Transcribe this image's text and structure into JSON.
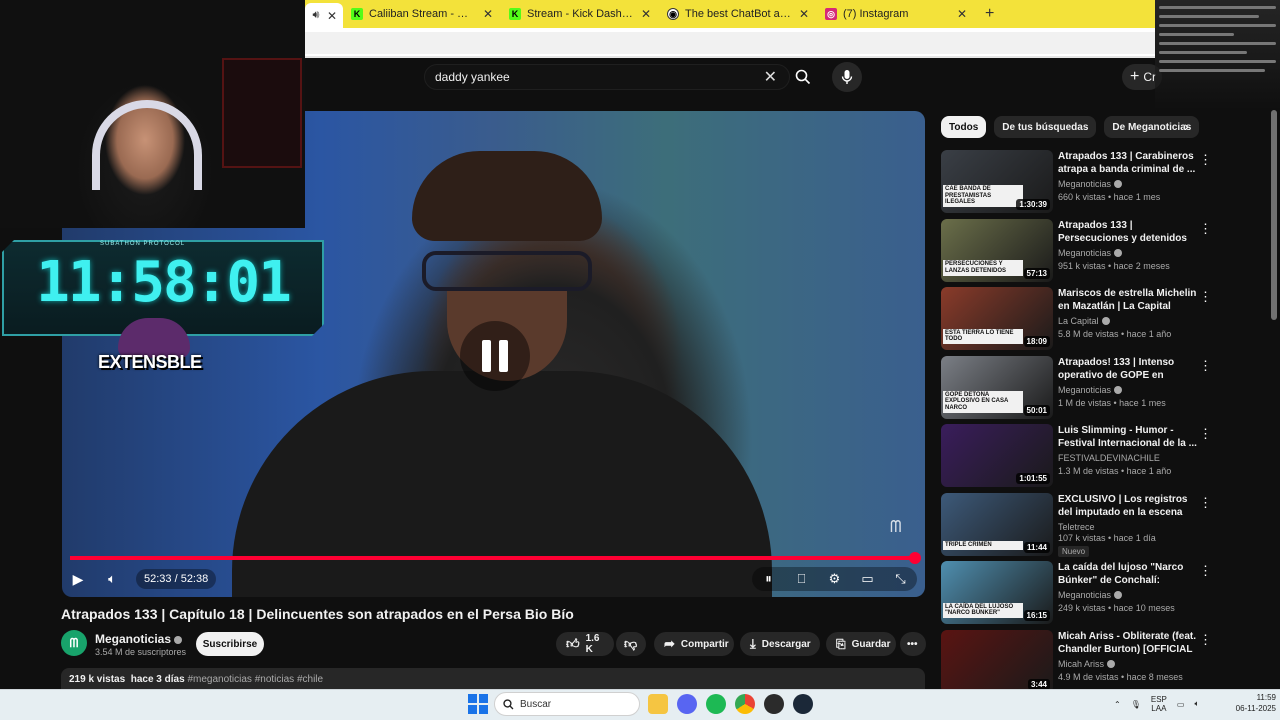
{
  "browser": {
    "tabs": [
      {
        "title": "",
        "active": true,
        "favicon": "speaker-icon"
      },
      {
        "title": "Caliiban Stream - Watch Live on Kick",
        "favicon_color": "#53fc18",
        "favicon_letter": "K"
      },
      {
        "title": "Stream - Kick Dashboard",
        "favicon_color": "#53fc18",
        "favicon_letter": "K"
      },
      {
        "title": "The best ChatBot and Widgets",
        "favicon_color": "#ffffff",
        "favicon_letter": "◉"
      },
      {
        "title": "(7) Instagram",
        "favicon_color": "#d62976",
        "favicon_letter": "◎"
      }
    ],
    "newtab": "+",
    "tab_close": "✕"
  },
  "youtube": {
    "search_query": "daddy yankee",
    "create_label": "Cr"
  },
  "player": {
    "current_time": "52:33",
    "duration": "52:38",
    "time_display": "52:33 / 52:38",
    "progress": 0.998
  },
  "video": {
    "title": "Atrapados 133 | Capítulo 18 | Delincuentes son atrapados en el Persa Bio Bío",
    "channel": "Meganoticias",
    "subscribers": "3.54 M de suscriptores",
    "subscribe_label": "Suscribirse",
    "likes": "1.6 K",
    "share_label": "Compartir",
    "download_label": "Descargar",
    "save_label": "Guardar",
    "views": "219 k vistas",
    "age": "hace 3 días",
    "tags": "#meganoticias #noticias #chile"
  },
  "sidebar": {
    "chips": [
      "Todos",
      "De tus búsquedas",
      "De Meganoticias"
    ],
    "recommendations": [
      {
        "title": "Atrapados 133 | Carabineros atrapa a banda criminal de ...",
        "channel": "Meganoticias",
        "verified": true,
        "meta": "660 k vistas • hace 1 mes",
        "duration": "1:30:39",
        "banner": "CAE BANDA DE PRESTAMISTAS ILEGALES",
        "thumb": "#3a3f46"
      },
      {
        "title": "Atrapados 133 | Persecuciones y detenidos en las calles: El ...",
        "channel": "Meganoticias",
        "verified": true,
        "meta": "951 k vistas • hace 2 meses",
        "duration": "57:13",
        "banner": "PERSECUCIONES Y LANZAS DETENIDOS",
        "thumb": "#6b6f4a"
      },
      {
        "title": "Mariscos de estrella Michelin en Mazatlán | La Capital",
        "channel": "La Capital",
        "verified": true,
        "meta": "5.8 M de vistas • hace 1 año",
        "duration": "18:09",
        "banner": "ESTA TIERRA LO TIENE TODO",
        "thumb": "#8a3b2a"
      },
      {
        "title": "Atrapados! 133 | Intenso operativo de GOPE en Melipill...",
        "channel": "Meganoticias",
        "verified": true,
        "meta": "1 M de vistas • hace 1 mes",
        "duration": "50:01",
        "banner": "GOPE DETONA EXPLOSIVO EN CASA NARCO",
        "thumb": "#7b7f86"
      },
      {
        "title": "Luis Slimming - Humor - Festival Internacional de la ...",
        "channel": "FESTIVALDEVINACHILE",
        "verified": false,
        "meta": "1.3 M de vistas • hace 1 año",
        "duration": "1:01:55",
        "banner": "",
        "thumb": "#3a1d5c"
      },
      {
        "title": "EXCLUSIVO | Los registros del imputado en la escena del tripl...",
        "channel": "Teletrece",
        "verified": false,
        "meta": "107 k vistas • hace 1 día",
        "duration": "11:44",
        "banner": "TRIPLE CRIMEN",
        "badge": "Nuevo",
        "thumb": "#3d5a7a"
      },
      {
        "title": "La caída del lujoso \"Narco Búnker\" de Conchalí: Contaba ...",
        "channel": "Meganoticias",
        "verified": true,
        "meta": "249 k vistas • hace 10 meses",
        "duration": "16:15",
        "banner": "LA CAÍDA DEL LUJOSO \"NARCO BÚNKER\"",
        "thumb": "#4f8fb0"
      },
      {
        "title": "Micah Ariss - Obliterate (feat. Chandler Burton) [OFFICIAL ...",
        "channel": "Micah Ariss",
        "verified": true,
        "meta": "4.9 M de vistas • hace 8 meses",
        "duration": "3:44",
        "banner": "",
        "thumb": "#5a1412"
      }
    ]
  },
  "overlay": {
    "timer": "11:58:01",
    "timer_label": "SUBATHON PROTOCOL",
    "brand": "EXTENSBLE"
  },
  "taskbar": {
    "search_placeholder": "Buscar",
    "lang_top": "ESP",
    "lang_bottom": "LAA",
    "time": "11:59",
    "date": "06-11-2025"
  }
}
